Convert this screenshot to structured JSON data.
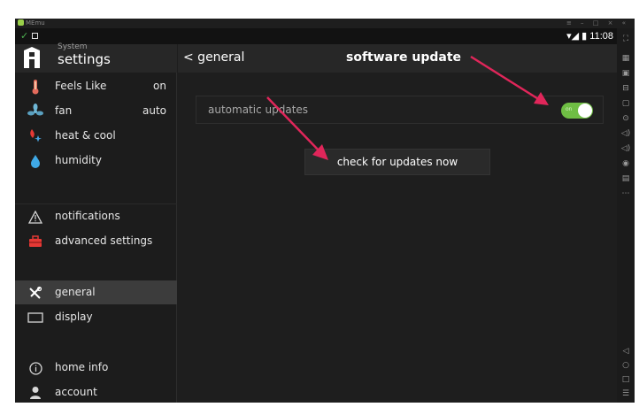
{
  "emulator": {
    "title": "MEmu",
    "window_controls": "≡ – □ ×  «",
    "side_tools": [
      "⛶",
      "▦",
      "▣",
      "⊟",
      "▢",
      "⊙",
      "◁)",
      "◁)",
      "◉",
      "▤",
      "⋯"
    ],
    "nav_tools": [
      "◁",
      "○",
      "□",
      "☰"
    ]
  },
  "status_bar": {
    "time": "11:08",
    "check": "✓",
    "signal": "▾◢ ▮"
  },
  "sidebar": {
    "section_label": "System",
    "title": "settings",
    "items": [
      {
        "label": "Feels Like",
        "value": "on"
      },
      {
        "label": "fan",
        "value": "auto"
      },
      {
        "label": "heat & cool"
      },
      {
        "label": "humidity"
      },
      {
        "label": "notifications"
      },
      {
        "label": "advanced settings"
      },
      {
        "label": "general"
      },
      {
        "label": "display"
      },
      {
        "label": "home info"
      },
      {
        "label": "account"
      }
    ]
  },
  "header": {
    "back_label": "< general",
    "title": "software update"
  },
  "settings": {
    "automatic_updates_label": "automatic updates",
    "toggle_text": "on",
    "automatic_updates_on": true,
    "check_button_label": "check for updates now"
  },
  "colors": {
    "toggle_on": "#6fbe44",
    "annotation_arrow": "#e0265a"
  }
}
